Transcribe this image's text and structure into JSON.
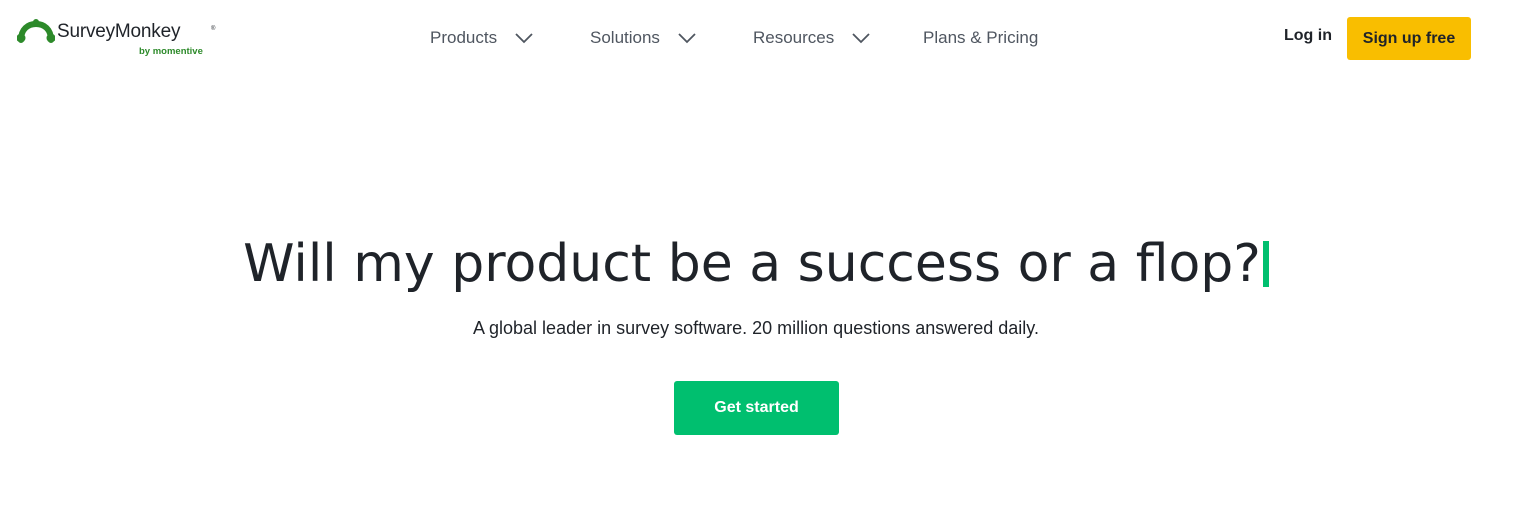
{
  "brand": {
    "name": "SurveyMonkey",
    "trademark": "®",
    "byline": "by momentive",
    "colors": {
      "logo_green": "#2d8a2a",
      "byline_green": "#2d8a2a"
    }
  },
  "nav": {
    "items": [
      {
        "label": "Products",
        "has_dropdown": true,
        "icon": "chevron-down-icon"
      },
      {
        "label": "Solutions",
        "has_dropdown": true,
        "icon": "chevron-down-icon"
      },
      {
        "label": "Resources",
        "has_dropdown": true,
        "icon": "chevron-down-icon"
      },
      {
        "label": "Plans & Pricing",
        "has_dropdown": false
      }
    ]
  },
  "auth": {
    "login_label": "Log in",
    "signup_label": "Sign up free",
    "signup_color": "#f9be00"
  },
  "hero": {
    "title": "Will my product be a success or a flop?",
    "subtitle": "A global leader in survey software. 20 million questions answered daily.",
    "cta_label": "Get started",
    "cta_color": "#00bf6f",
    "cursor_color": "#00bf6f"
  }
}
